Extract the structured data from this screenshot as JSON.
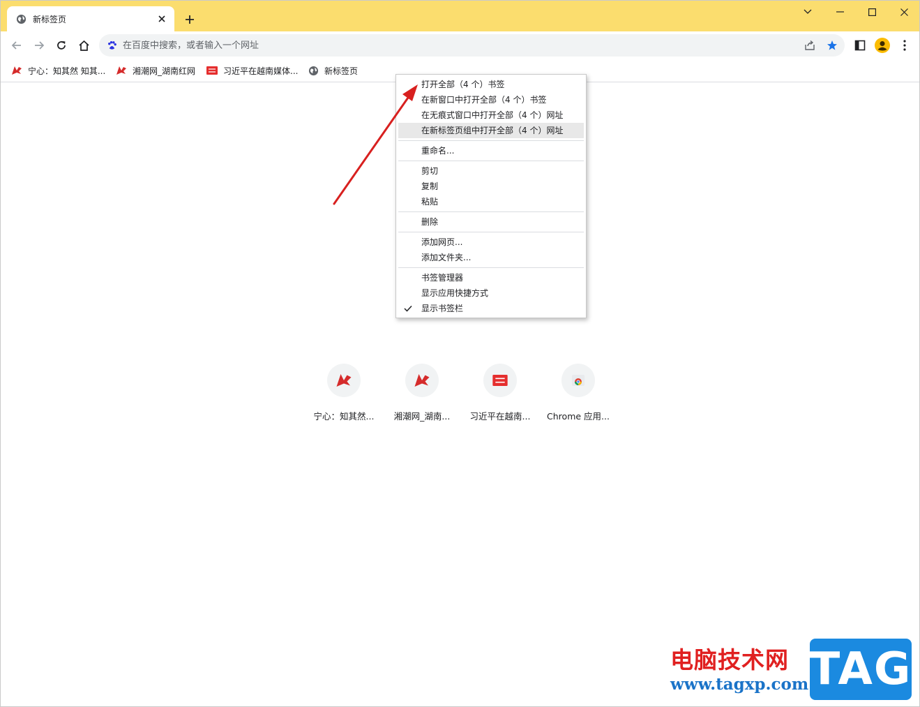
{
  "tab": {
    "title": "新标签页",
    "icon": "globe-icon"
  },
  "omnibox": {
    "placeholder": "在百度中搜索，或者输入一个网址",
    "search_engine_icon": "baidu-paw-icon"
  },
  "bookmarks": [
    {
      "label": "宁心：知其然 知其...",
      "icon": "red-logo-icon"
    },
    {
      "label": "湘潮网_湖南红网",
      "icon": "red-logo-icon"
    },
    {
      "label": "习近平在越南媒体...",
      "icon": "toutiao-icon"
    },
    {
      "label": "新标签页",
      "icon": "globe-icon"
    }
  ],
  "shortcuts": [
    {
      "label": "宁心：知其然...",
      "icon": "red-logo-icon"
    },
    {
      "label": "湘潮网_湖南...",
      "icon": "red-logo-icon"
    },
    {
      "label": "习近平在越南...",
      "icon": "toutiao-icon"
    },
    {
      "label": "Chrome 应用...",
      "icon": "chrome-icon"
    }
  ],
  "context_menu": {
    "group1": [
      "打开全部（4 个）书签",
      "在新窗口中打开全部（4 个）书签",
      "在无痕式窗口中打开全部（4 个）网址",
      "在新标签页组中打开全部（4 个）网址"
    ],
    "rename": "重命名...",
    "cut": "剪切",
    "copy": "复制",
    "paste": "粘贴",
    "delete": "删除",
    "add_page": "添加网页...",
    "add_folder": "添加文件夹...",
    "bookmark_manager": "书签管理器",
    "show_apps_shortcut": "显示应用快捷方式",
    "show_bookmarks_bar": "显示书签栏",
    "show_bookmarks_bar_checked": true
  },
  "watermark": {
    "site_name": "电脑技术网",
    "url": "www.tagxp.com",
    "logo": "TAG"
  },
  "colors": {
    "tabstrip": "#fbdd6e",
    "accent_blue": "#1a73e8",
    "annotation_red": "#d8201f",
    "watermark_red": "#e02020",
    "watermark_blue": "#1b8ae0"
  }
}
